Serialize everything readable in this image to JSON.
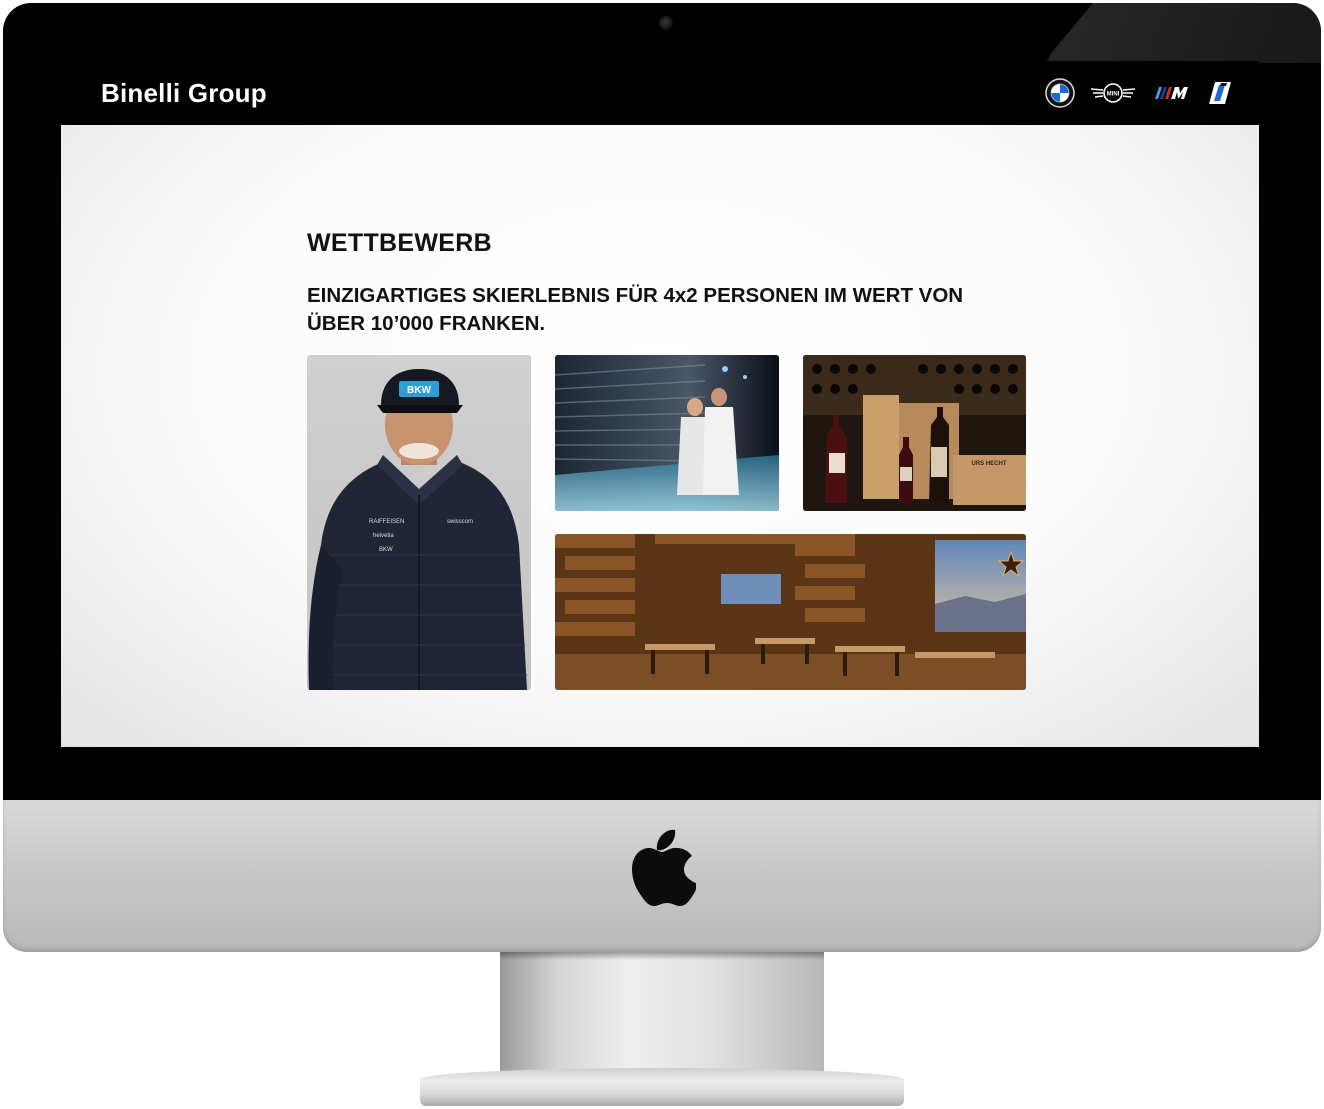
{
  "site": {
    "brand": "Binelli Group",
    "brand_logos": [
      "bmw-logo",
      "mini-logo",
      "m-logo",
      "bmw-i-logo"
    ]
  },
  "main": {
    "title": "WETTBEWERB",
    "subtitle": "EINZIGARTIGES SKIERLEBNIS FÜR 4x2 PERSONEN IM WERT VON ÜBER 10’000 FRANKEN."
  },
  "gallery": {
    "skier": {
      "cap_text": "BKW",
      "badges": [
        "RAIFFEISEN",
        "helvetia",
        "BKW",
        "swisscom"
      ]
    },
    "wine": {
      "label_text": "URS HECHT"
    }
  },
  "colors": {
    "header_bg": "#000000",
    "header_text": "#ffffff",
    "heading_text": "#111111",
    "screen_bg": "#ffffff"
  }
}
